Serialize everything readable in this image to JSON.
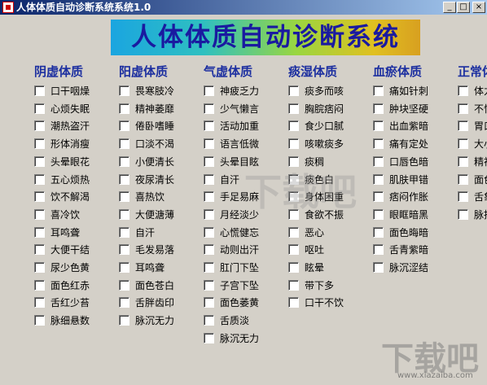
{
  "window": {
    "title": "人体体质自动诊断系统系统1.0",
    "min_label": "_",
    "max_label": "□",
    "close_label": "×"
  },
  "banner": {
    "text": "人体体质自动诊断系统"
  },
  "columns": [
    {
      "header": "阴虚体质",
      "items": [
        "口干咽燥",
        "心烦失眠",
        "潮热盗汗",
        "形体消瘦",
        "头晕眼花",
        "五心烦热",
        "饮不解渴",
        "喜冷饮",
        "耳鸣聋",
        "大便干结",
        "尿少色黄",
        "面色红赤",
        "舌红少苔",
        "脉细悬数"
      ]
    },
    {
      "header": "阳虚体质",
      "items": [
        "畏寒肢冷",
        "精神萎靡",
        "倦卧嗜睡",
        "口淡不渴",
        "小便清长",
        "夜尿清长",
        "喜热饮",
        "大便溏薄",
        "自汗",
        "毛发易落",
        "耳鸣聋",
        "面色苍白",
        "舌胖齿印",
        "脉沉无力"
      ]
    },
    {
      "header": "气虚体质",
      "items": [
        "神疲乏力",
        "少气懒言",
        "活动加重",
        "语言低微",
        "头晕目眩",
        "自汗",
        "手足易麻",
        "月经淡少",
        "心慌健忘",
        "动则出汗",
        "肛门下坠",
        "子宫下坠",
        "面色萎黄",
        "舌质淡",
        "脉沉无力"
      ]
    },
    {
      "header": "痰湿体质",
      "items": [
        "痰多而咳",
        "胸脘痞闷",
        "食少口腻",
        "咳嗽痰多",
        "痰稠",
        "痰色白",
        "身体困重",
        "食欲不振",
        "恶心",
        "呕吐",
        "眩晕",
        "带下多",
        "口干不饮"
      ]
    },
    {
      "header": "血瘀体质",
      "items": [
        "痛如针刺",
        "肿块坚硬",
        "出血紫暗",
        "痛有定处",
        "口唇色暗",
        "肌肤甲错",
        "痞闷作胀",
        "眼眶暗黑",
        "面色晦暗",
        "舌青紫暗",
        "脉沉涩结"
      ]
    },
    {
      "header": "正常体质",
      "items": [
        "体力",
        "不怕",
        "胃口",
        "大小",
        "精神",
        "面色",
        "舌象",
        "脉搏"
      ]
    }
  ],
  "watermarks": {
    "center": "下载吧",
    "corner": "下载吧",
    "url": "www.xiazaiba.com"
  }
}
